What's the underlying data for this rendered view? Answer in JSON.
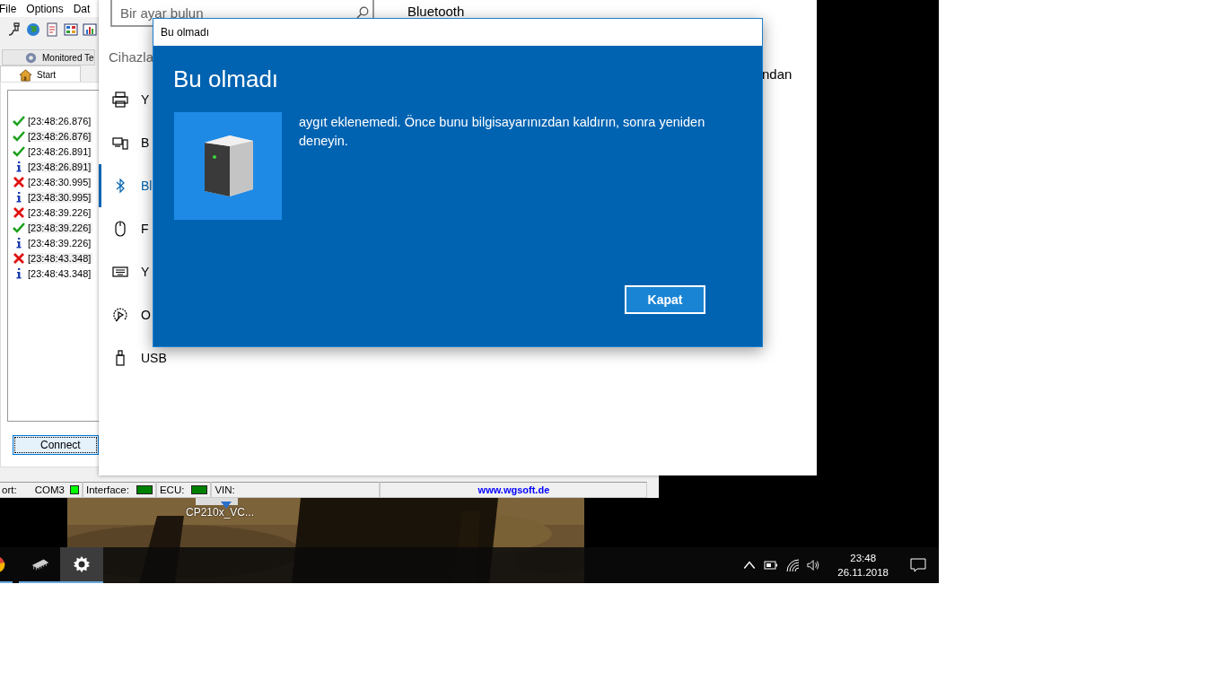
{
  "app_window": {
    "menu": [
      "File",
      "Options",
      "Dat"
    ],
    "tabs": [
      {
        "label": "Monitored Te",
        "selected": false
      },
      {
        "label": "Start",
        "selected": true
      }
    ],
    "log": [
      {
        "kind": "ok",
        "time": "[23:48:26.876]"
      },
      {
        "kind": "ok",
        "time": "[23:48:26.876]"
      },
      {
        "kind": "ok",
        "time": "[23:48:26.891]"
      },
      {
        "kind": "info",
        "time": "[23:48:26.891]"
      },
      {
        "kind": "error",
        "time": "[23:48:30.995]"
      },
      {
        "kind": "info",
        "time": "[23:48:30.995]"
      },
      {
        "kind": "error",
        "time": "[23:48:39.226]"
      },
      {
        "kind": "ok",
        "time": "[23:48:39.226]"
      },
      {
        "kind": "info",
        "time": "[23:48:39.226]"
      },
      {
        "kind": "error",
        "time": "[23:48:43.348]"
      },
      {
        "kind": "info",
        "time": "[23:48:43.348]"
      }
    ],
    "connect_button": "Connect",
    "status_bar": {
      "port_label": "ort:",
      "port": "COM3",
      "leds": [
        {
          "label": "Interface:",
          "color": "#008000"
        },
        {
          "label": "ECU:",
          "color": "#008000"
        }
      ],
      "port_led": {
        "color": "#00ff00"
      },
      "vin_label": "VIN:",
      "website": "www.wgsoft.de"
    }
  },
  "settings_window": {
    "search": {
      "placeholder": "Bir ayar bulun"
    },
    "section": "Cihazla",
    "nav": [
      {
        "label": "Y",
        "selected": false
      },
      {
        "label": "B",
        "selected": false
      },
      {
        "label": "Bl",
        "selected": true
      },
      {
        "label": "F",
        "selected": false
      },
      {
        "label": "Y",
        "selected": false
      },
      {
        "label": "O",
        "selected": false
      },
      {
        "label": "USB",
        "selected": false
      }
    ],
    "page_title": "Bluetooth",
    "fragment": "ndan"
  },
  "dialog": {
    "title": "Bu olmadı",
    "heading": "Bu olmadı",
    "message": "aygıt eklenemedi. Önce bunu bilgisayarınızdan kaldırın, sonra yeniden deneyin.",
    "button": "Kapat"
  },
  "desktop": {
    "icon_label": "CP210x_VC..."
  },
  "taskbar": {
    "apps": [
      {
        "selected": false
      },
      {
        "selected": false
      },
      {
        "selected": true
      }
    ],
    "time": "23:48",
    "date": "26.11.2018"
  }
}
